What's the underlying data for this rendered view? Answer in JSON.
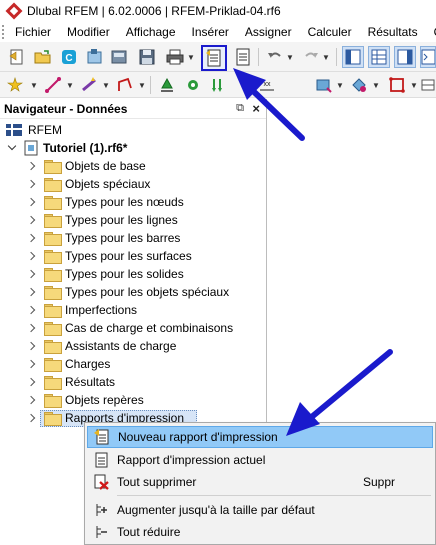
{
  "window": {
    "title": "Dlubal RFEM | 6.02.0006 | RFEM-Priklad-04.rf6"
  },
  "menu": [
    "Fichier",
    "Modifier",
    "Affichage",
    "Insérer",
    "Assigner",
    "Calculer",
    "Résultats",
    "Ou"
  ],
  "navigator": {
    "title": "Navigateur - Données",
    "root": "RFEM",
    "model": "Tutoriel (1).rf6*",
    "items": [
      "Objets de base",
      "Objets spéciaux",
      "Types pour les nœuds",
      "Types pour les lignes",
      "Types pour les barres",
      "Types pour les surfaces",
      "Types pour les solides",
      "Types pour les objets spéciaux",
      "Imperfections",
      "Cas de charge et combinaisons",
      "Assistants de charge",
      "Charges",
      "Résultats",
      "Objets repères",
      "Rapports d'impression"
    ]
  },
  "context_menu": {
    "items": [
      {
        "label": "Nouveau rapport d'impression",
        "icon": "new-report-icon",
        "highlighted": true
      },
      {
        "label": "Rapport d'impression actuel",
        "icon": "document-icon"
      },
      {
        "label": "Tout supprimer",
        "icon": "delete-all-icon",
        "shortcut": "Suppr"
      },
      {
        "label": "Augmenter jusqu'à la taille par défaut",
        "icon": "expand-all-icon"
      },
      {
        "label": "Tout réduire",
        "icon": "collapse-all-icon"
      }
    ]
  },
  "colors": {
    "annotation_arrow": "#1a1acc",
    "highlight": "#91c9f7",
    "selection": "#d7e5f7",
    "folder": "#f6d97b"
  }
}
